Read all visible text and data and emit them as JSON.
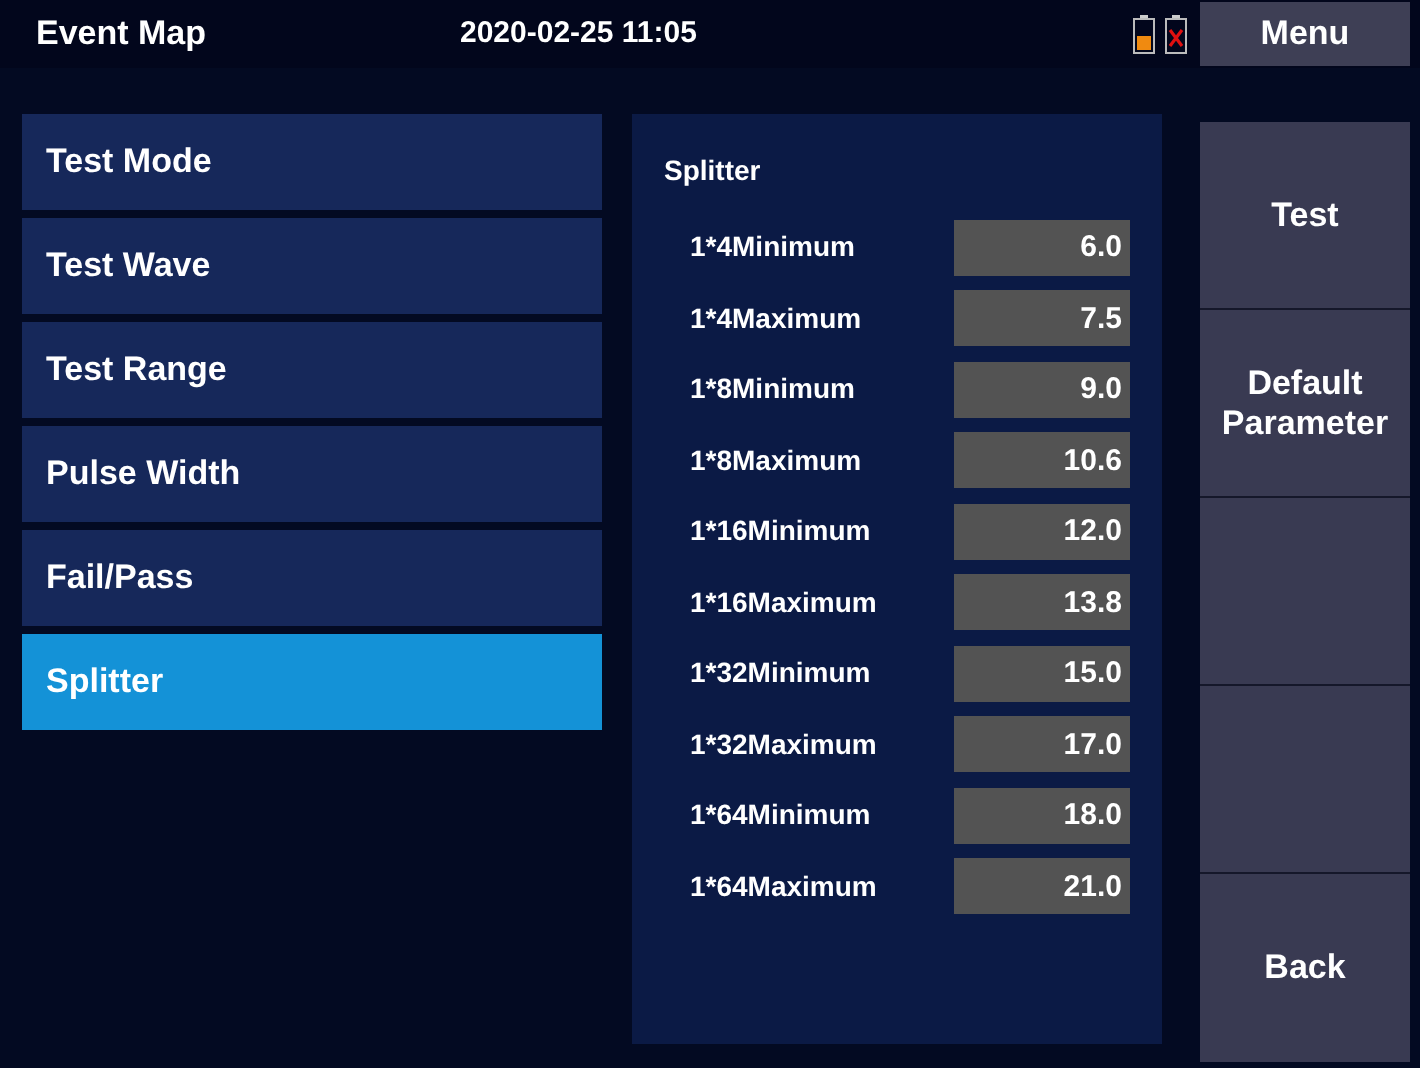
{
  "header": {
    "title": "Event Map",
    "datetime": "2020-02-25 11:05",
    "menu_button": "Menu"
  },
  "sidebar": {
    "items": [
      {
        "label": "Test Mode",
        "selected": false
      },
      {
        "label": "Test Wave",
        "selected": false
      },
      {
        "label": "Test Range",
        "selected": false
      },
      {
        "label": "Pulse Width",
        "selected": false
      },
      {
        "label": "Fail/Pass",
        "selected": false
      },
      {
        "label": "Splitter",
        "selected": true
      }
    ]
  },
  "panel": {
    "title": "Splitter",
    "rows": [
      {
        "label": "1*4Minimum",
        "value": "6.0"
      },
      {
        "label": "1*4Maximum",
        "value": "7.5"
      },
      {
        "label": "1*8Minimum",
        "value": "9.0"
      },
      {
        "label": "1*8Maximum",
        "value": "10.6"
      },
      {
        "label": "1*16Minimum",
        "value": "12.0"
      },
      {
        "label": "1*16Maximum",
        "value": "13.8"
      },
      {
        "label": "1*32Minimum",
        "value": "15.0"
      },
      {
        "label": "1*32Maximum",
        "value": "17.0"
      },
      {
        "label": "1*64Minimum",
        "value": "18.0"
      },
      {
        "label": "1*64Maximum",
        "value": "21.0"
      }
    ]
  },
  "side_buttons": [
    {
      "kind": "label",
      "label": "Test"
    },
    {
      "kind": "label",
      "label": "Default Parameter"
    },
    {
      "kind": "blank"
    },
    {
      "kind": "blank"
    },
    {
      "kind": "label",
      "label": "Back"
    }
  ]
}
